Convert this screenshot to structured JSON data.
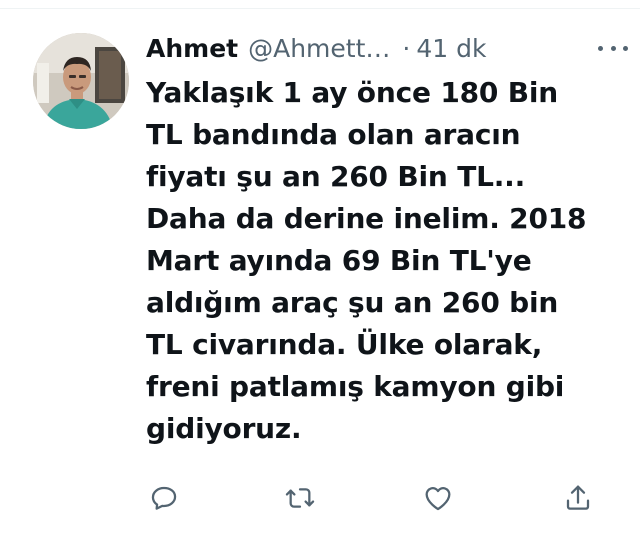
{
  "tweet": {
    "author": {
      "display_name": "Ahmet",
      "handle": "@Ahmett…",
      "avatar_icon": "profile-photo"
    },
    "separator": "·",
    "time": "41 dk",
    "text": "Yaklaşık 1 ay önce 180 Bin\nTL bandında olan aracın\nfiyatı şu an 260 Bin TL...\nDaha da derine inelim. 2018\nMart ayında 69 Bin TL'ye\naldığım araç şu an 260 bin\nTL civarında. Ülke olarak,\nfreni patlamış kamyon gibi\ngidiyoruz.",
    "actions": {
      "reply_icon": "comment-icon",
      "retweet_icon": "retweet-icon",
      "like_icon": "heart-icon",
      "share_icon": "share-icon"
    }
  },
  "colors": {
    "text_primary": "#0f1419",
    "text_secondary": "#536471",
    "divider": "#eff3f4"
  }
}
